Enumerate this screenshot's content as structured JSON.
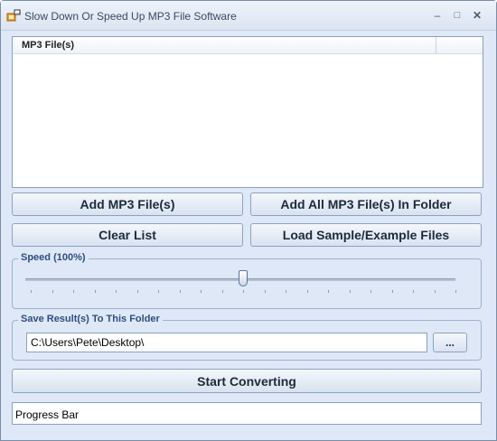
{
  "window": {
    "title": "Slow Down Or Speed Up MP3 File Software",
    "controls": {
      "minimize": "–",
      "maximize": "□",
      "close": "✕"
    }
  },
  "file_list": {
    "column_header": "MP3 File(s)",
    "rows": []
  },
  "buttons": {
    "add_files": "Add MP3 File(s)",
    "add_folder": "Add All MP3 File(s) In Folder",
    "clear_list": "Clear List",
    "load_samples": "Load Sample/Example Files",
    "browse": "...",
    "start": "Start Converting"
  },
  "speed": {
    "label": "Speed (100%)",
    "value_percent": 100,
    "slider_position_fraction": 0.5,
    "tick_count": 21
  },
  "save_folder": {
    "label": "Save Result(s) To This Folder",
    "path": "C:\\Users\\Pete\\Desktop\\"
  },
  "progress": {
    "text": "Progress Bar"
  },
  "colors": {
    "window_bg": "#dfe8f6",
    "group_label": "#2f4d80",
    "border": "#8aa0bd"
  },
  "icons": {
    "app": "audio-app-icon",
    "minimize": "minimize-icon",
    "maximize": "maximize-icon",
    "close": "close-icon"
  }
}
